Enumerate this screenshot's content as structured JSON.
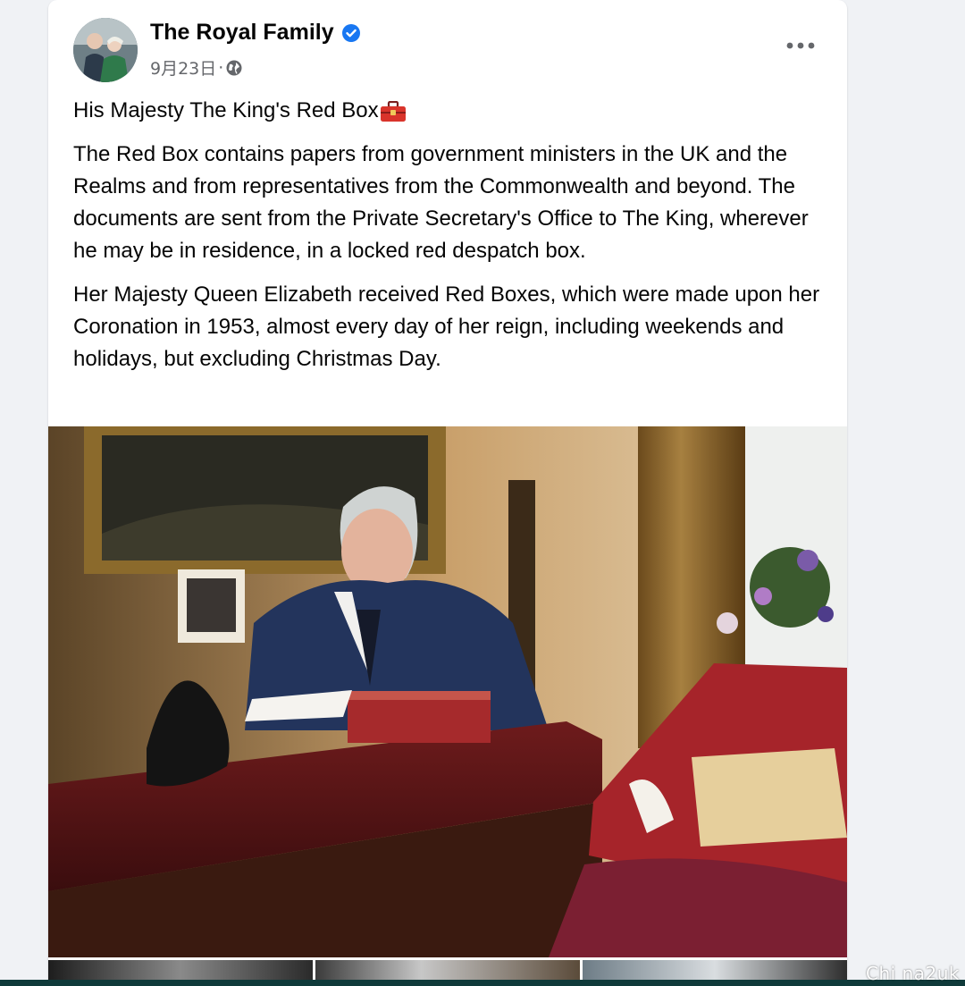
{
  "post": {
    "page_name": "The Royal Family",
    "date": "9月23日",
    "separator": "·",
    "privacy_icon": "globe-icon",
    "verified_icon": "verified-badge-icon",
    "more_icon": "more-options-icon",
    "title": "His Majesty The King's Red Box",
    "title_emoji_icon": "toolbox-icon",
    "paragraph_1": "The Red Box contains papers from government ministers in the UK and the Realms and from representatives from the Commonwealth and beyond. The documents are sent from the Private Secretary's Office to The King, wherever he may be in residence, in a locked red despatch box.",
    "paragraph_2": "Her Majesty Queen Elizabeth received Red Boxes, which were made upon her Coronation in 1953, almost every day of her reign, including weekends and holidays, but excluding Christmas Day."
  },
  "watermark": "Chi na2uk",
  "colors": {
    "verified_blue": "#1877f2",
    "secondary_text": "#65676b",
    "primary_text": "#050505"
  }
}
